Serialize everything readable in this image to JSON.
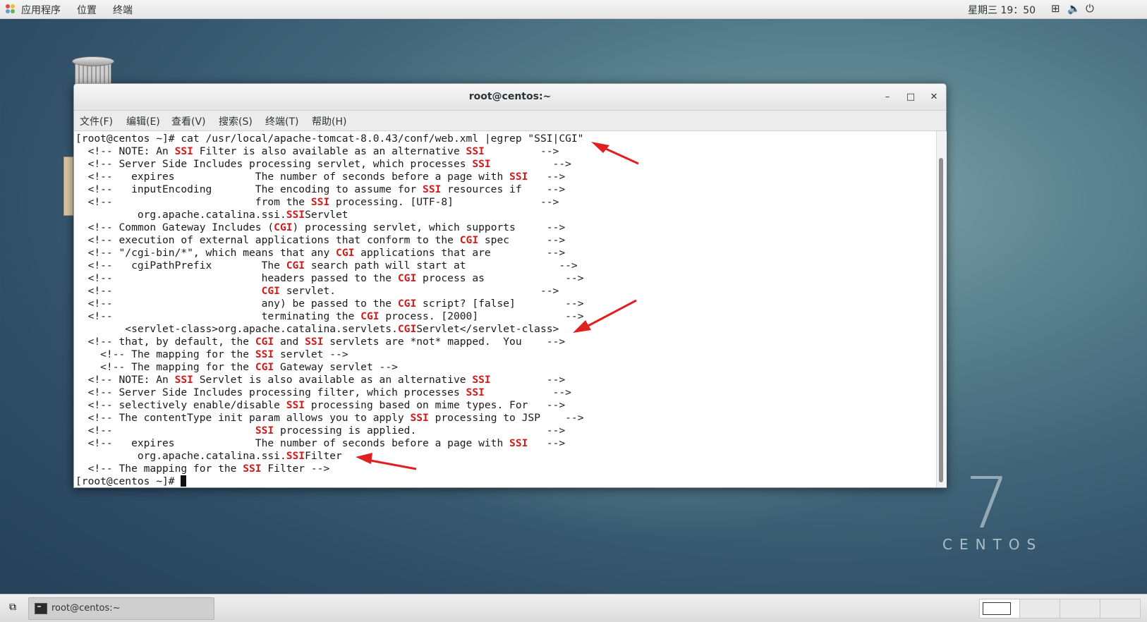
{
  "topbar": {
    "apps": "应用程序",
    "places": "位置",
    "terminal": "终端",
    "clock": "星期三 19：50",
    "network_icon": "network-icon",
    "volume_icon": "volume-icon",
    "power_icon": "power-icon"
  },
  "window": {
    "title": "root@centos:~",
    "minimize": "–",
    "maximize": "□",
    "close": "✕",
    "menu": [
      "文件(F)",
      "编辑(E)",
      "查看(V)",
      "搜索(S)",
      "终端(T)",
      "帮助(H)"
    ]
  },
  "terminal": {
    "lines": [
      [
        [
          "[root@centos ~]# cat /usr/local/apache-tomcat-8.0.43/conf/web.xml |egrep \"SSI|CGI\"",
          0
        ]
      ],
      [
        [
          "  <!-- NOTE: An ",
          0
        ],
        [
          "SSI",
          1
        ],
        [
          " Filter is also available as an alternative ",
          0
        ],
        [
          "SSI",
          1
        ],
        [
          "         -->",
          0
        ]
      ],
      [
        [
          "  <!-- Server Side Includes processing servlet, which processes ",
          0
        ],
        [
          "SSI",
          1
        ],
        [
          "          -->",
          0
        ]
      ],
      [
        [
          "  <!--   expires             The number of seconds before a page with ",
          0
        ],
        [
          "SSI",
          1
        ],
        [
          "   -->",
          0
        ]
      ],
      [
        [
          "  <!--   inputEncoding       The encoding to assume for ",
          0
        ],
        [
          "SSI",
          1
        ],
        [
          " resources if    -->",
          0
        ]
      ],
      [
        [
          "  <!--                       from the ",
          0
        ],
        [
          "SSI",
          1
        ],
        [
          " processing. [UTF-8]              -->",
          0
        ]
      ],
      [
        [
          "          org.apache.catalina.ssi.",
          0
        ],
        [
          "SSI",
          1
        ],
        [
          "Servlet",
          0
        ]
      ],
      [
        [
          "  <!-- Common Gateway Includes (",
          0
        ],
        [
          "CGI",
          1
        ],
        [
          ") processing servlet, which supports     -->",
          0
        ]
      ],
      [
        [
          "  <!-- execution of external applications that conform to the ",
          0
        ],
        [
          "CGI",
          1
        ],
        [
          " spec      -->",
          0
        ]
      ],
      [
        [
          "  <!-- \"/cgi-bin/*\", which means that any ",
          0
        ],
        [
          "CGI",
          1
        ],
        [
          " applications that are         -->",
          0
        ]
      ],
      [
        [
          "  <!--   cgiPathPrefix        The ",
          0
        ],
        [
          "CGI",
          1
        ],
        [
          " search path will start at               -->",
          0
        ]
      ],
      [
        [
          "  <!--                        headers passed to the ",
          0
        ],
        [
          "CGI",
          1
        ],
        [
          " process as             -->",
          0
        ]
      ],
      [
        [
          "  <!--                        ",
          0
        ],
        [
          "CGI",
          1
        ],
        [
          " servlet.                                 -->",
          0
        ]
      ],
      [
        [
          "  <!--                        any) be passed to the ",
          0
        ],
        [
          "CGI",
          1
        ],
        [
          " script? [false]        -->",
          0
        ]
      ],
      [
        [
          "  <!--                        terminating the ",
          0
        ],
        [
          "CGI",
          1
        ],
        [
          " process. [2000]              -->",
          0
        ]
      ],
      [
        [
          "        <servlet-class>org.apache.catalina.servlets.",
          0
        ],
        [
          "CGI",
          1
        ],
        [
          "Servlet</servlet-class>",
          0
        ]
      ],
      [
        [
          "  <!-- that, by default, the ",
          0
        ],
        [
          "CGI",
          1
        ],
        [
          " and ",
          0
        ],
        [
          "SSI",
          1
        ],
        [
          " servlets are *not* mapped.  You    -->",
          0
        ]
      ],
      [
        [
          "    <!-- The mapping for the ",
          0
        ],
        [
          "SSI",
          1
        ],
        [
          " servlet -->",
          0
        ]
      ],
      [
        [
          "    <!-- The mapping for the ",
          0
        ],
        [
          "CGI",
          1
        ],
        [
          " Gateway servlet -->",
          0
        ]
      ],
      [
        [
          "  <!-- NOTE: An ",
          0
        ],
        [
          "SSI",
          1
        ],
        [
          " Servlet is also available as an alternative ",
          0
        ],
        [
          "SSI",
          1
        ],
        [
          "         -->",
          0
        ]
      ],
      [
        [
          "  <!-- Server Side Includes processing filter, which processes ",
          0
        ],
        [
          "SSI",
          1
        ],
        [
          "           -->",
          0
        ]
      ],
      [
        [
          "  <!-- selectively enable/disable ",
          0
        ],
        [
          "SSI",
          1
        ],
        [
          " processing based on mime types. For   -->",
          0
        ]
      ],
      [
        [
          "  <!-- The contentType init param allows you to apply ",
          0
        ],
        [
          "SSI",
          1
        ],
        [
          " processing to JSP    -->",
          0
        ]
      ],
      [
        [
          "  <!--                       ",
          0
        ],
        [
          "SSI",
          1
        ],
        [
          " processing is applied.                     -->",
          0
        ]
      ],
      [
        [
          "  <!--   expires             The number of seconds before a page with ",
          0
        ],
        [
          "SSI",
          1
        ],
        [
          "   -->",
          0
        ]
      ],
      [
        [
          "          org.apache.catalina.ssi.",
          0
        ],
        [
          "SSI",
          1
        ],
        [
          "Filter",
          0
        ]
      ],
      [
        [
          "  <!-- The mapping for the ",
          0
        ],
        [
          "SSI",
          1
        ],
        [
          " Filter -->",
          0
        ]
      ],
      [
        [
          "[root@centos ~]# ",
          0
        ]
      ]
    ]
  },
  "desktop": {
    "watermark_number": "7",
    "watermark_text": "CENTOS",
    "arrow_color": "#e02020"
  },
  "taskbar": {
    "task_label": "root@centos:~",
    "task_icon": "terminal-icon",
    "show_desktop_icon": "show-desktop-icon"
  }
}
